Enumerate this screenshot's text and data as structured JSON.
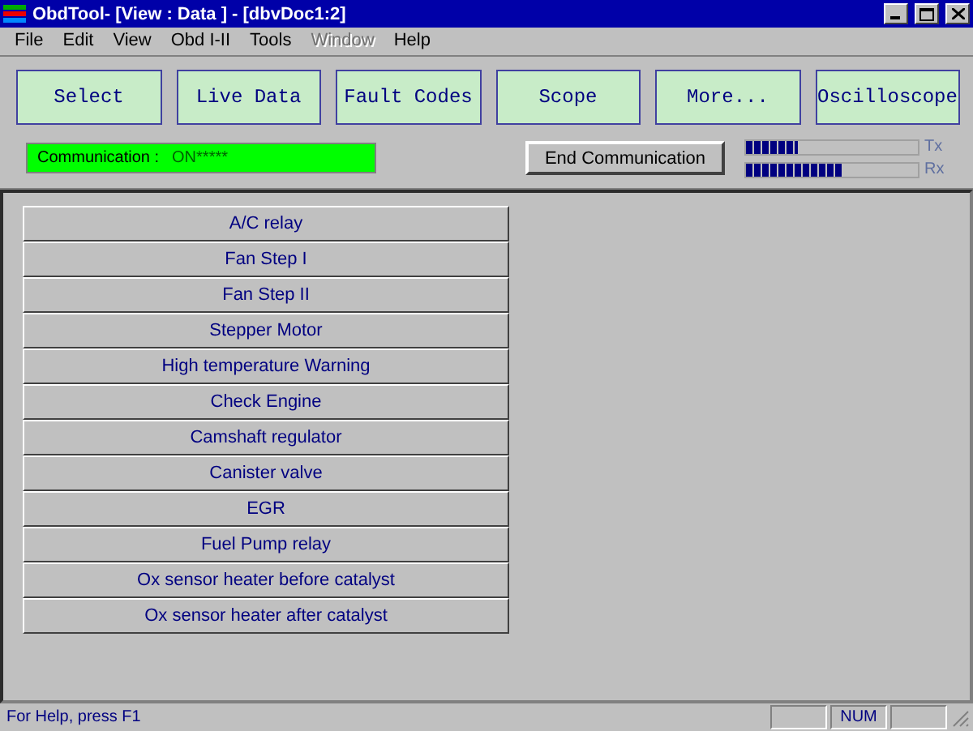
{
  "window": {
    "title": "ObdTool- [View : Data ] - [dbvDoc1:2]"
  },
  "menu": [
    {
      "label": "File",
      "disabled": false
    },
    {
      "label": "Edit",
      "disabled": false
    },
    {
      "label": "View",
      "disabled": false
    },
    {
      "label": "Obd I-II",
      "disabled": false
    },
    {
      "label": "Tools",
      "disabled": false
    },
    {
      "label": "Window",
      "disabled": true
    },
    {
      "label": "Help",
      "disabled": false
    }
  ],
  "toolbar_buttons": [
    "Select",
    "Live Data",
    "Fault Codes",
    "Scope",
    "More...",
    "Oscilloscope"
  ],
  "communication": {
    "label": "Communication  :",
    "status": "ON*****"
  },
  "end_button": "End Communication",
  "meters": [
    {
      "label": "Tx",
      "level": 0.3
    },
    {
      "label": "Rx",
      "level": 0.56
    }
  ],
  "items": [
    "A/C relay",
    "Fan Step I",
    "Fan Step II",
    "Stepper Motor",
    "High temperature Warning",
    "Check Engine",
    "Camshaft regulator",
    "Canister valve",
    "EGR",
    "Fuel Pump relay",
    "Ox sensor heater before catalyst",
    "Ox sensor heater after catalyst"
  ],
  "status_bar": {
    "help": "For Help, press F1",
    "num": "NUM"
  }
}
